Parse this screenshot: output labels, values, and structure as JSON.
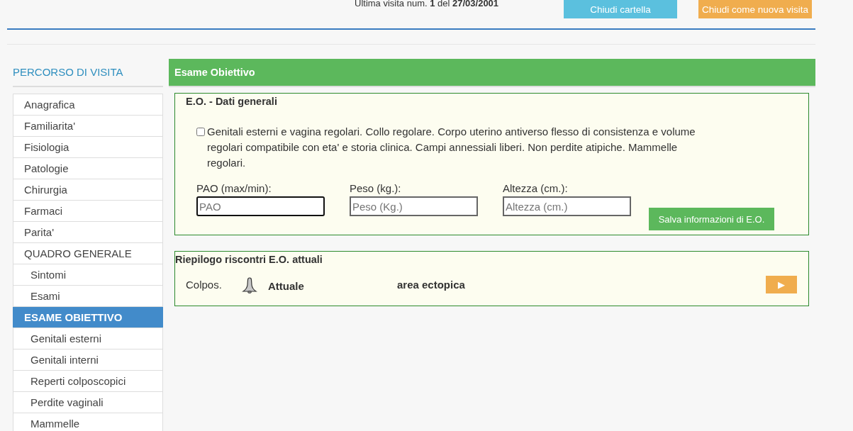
{
  "header": {
    "last_visit": "Ultima visita num. **1** del **27/03/2001**",
    "buttons": [
      {
        "label": "Chiudi cartella",
        "kind": "info"
      },
      {
        "label": "Chiudi come nuova visita",
        "kind": "warning"
      }
    ]
  },
  "sidebar": {
    "title": "PERCORSO DI VISITA",
    "items": [
      {
        "label": "Anagrafica",
        "kind": "item",
        "selected": false
      },
      {
        "label": "Familiarita'",
        "kind": "item",
        "selected": false
      },
      {
        "label": "Fisiologia",
        "kind": "item",
        "selected": false
      },
      {
        "label": "Patologie",
        "kind": "item",
        "selected": false
      },
      {
        "label": "Chirurgia",
        "kind": "item",
        "selected": false
      },
      {
        "label": "Farmaci",
        "kind": "item",
        "selected": false
      },
      {
        "label": "Parita'",
        "kind": "item",
        "selected": false
      },
      {
        "label": "QUADRO GENERALE",
        "kind": "item",
        "selected": false
      },
      {
        "label": "Sintomi",
        "kind": "sub",
        "selected": false
      },
      {
        "label": "Esami",
        "kind": "sub",
        "selected": false
      },
      {
        "label": "ESAME OBIETTIVO",
        "kind": "item",
        "selected": true
      },
      {
        "label": "Genitali esterni",
        "kind": "sub",
        "selected": false
      },
      {
        "label": "Genitali interni",
        "kind": "sub",
        "selected": false
      },
      {
        "label": "Reperti colposcopici",
        "kind": "sub",
        "selected": false
      },
      {
        "label": "Perdite vaginali",
        "kind": "sub",
        "selected": false
      },
      {
        "label": "Mammelle",
        "kind": "sub",
        "selected": false
      }
    ]
  },
  "main": {
    "title": "Esame Obiettivo",
    "general": {
      "title": "E.O. - Dati generali",
      "normal_check": {
        "label": "Genitali esterni e vagina regolari. Collo regolare. Corpo uterino antiverso flesso di consistenza e volume regolari compatibile con eta' e storia clinica. Campi annessiali liberi. Non perdite atipiche. Mammelle regolari.",
        "checked": false
      },
      "fields": [
        {
          "label": "PAO (max/min):",
          "placeholder": "PAO"
        },
        {
          "label": "Peso (kg.):",
          "placeholder": "Peso (Kg.)"
        },
        {
          "label": "Altezza (cm.):",
          "placeholder": "Altezza (cm.)"
        }
      ],
      "save_button": "Salva informazioni di E.O."
    },
    "summary": {
      "title": "Riepilogo riscontri E.O. attuali",
      "rows": [
        {
          "exam": "Colpos.",
          "status": "Attuale",
          "finding": "area ectopica",
          "action": "▶"
        }
      ]
    }
  }
}
